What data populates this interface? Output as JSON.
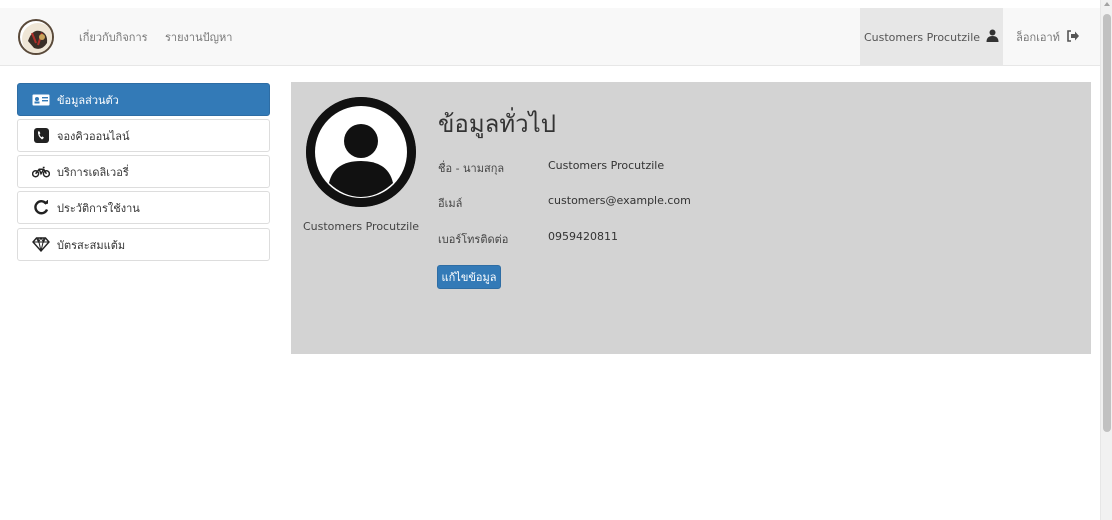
{
  "nav": {
    "logo_icon": "app-logo",
    "links": [
      "เกี่ยวกับกิจการ",
      "รายงานปัญหา"
    ],
    "user_name": "Customers Procutzile",
    "user_icon": "user-icon",
    "logout_label": "ล็อกเอาท์",
    "logout_icon": "logout-icon"
  },
  "sidebar": {
    "items": [
      {
        "label": "ข้อมูลส่วนตัว",
        "icon": "id-card-icon",
        "active": true
      },
      {
        "label": "จองคิวออนไลน์",
        "icon": "phone-icon",
        "active": false
      },
      {
        "label": "บริการเดลิเวอรี่",
        "icon": "motorcycle-icon",
        "active": false
      },
      {
        "label": "ประวัติการใช้งาน",
        "icon": "refresh-icon",
        "active": false
      },
      {
        "label": "บัตรสะสมแต้ม",
        "icon": "diamond-icon",
        "active": false
      }
    ]
  },
  "profile": {
    "avatar_icon": "user-avatar-icon",
    "display_name": "Customers Procutzile",
    "title": "ข้อมูลทั่วไป",
    "fields": [
      {
        "label": "ชื่อ - นามสกุล",
        "value": "Customers Procutzile"
      },
      {
        "label": "อีเมล์",
        "value": "customers@example.com"
      },
      {
        "label": "เบอร์โทรติดต่อ",
        "value": "0959420811"
      }
    ],
    "edit_label": "แก้ไขข้อมูล"
  },
  "colors": {
    "primary": "#337ab7",
    "navbar_bg": "#f8f8f8",
    "panel_bg": "#d3d3d3"
  }
}
